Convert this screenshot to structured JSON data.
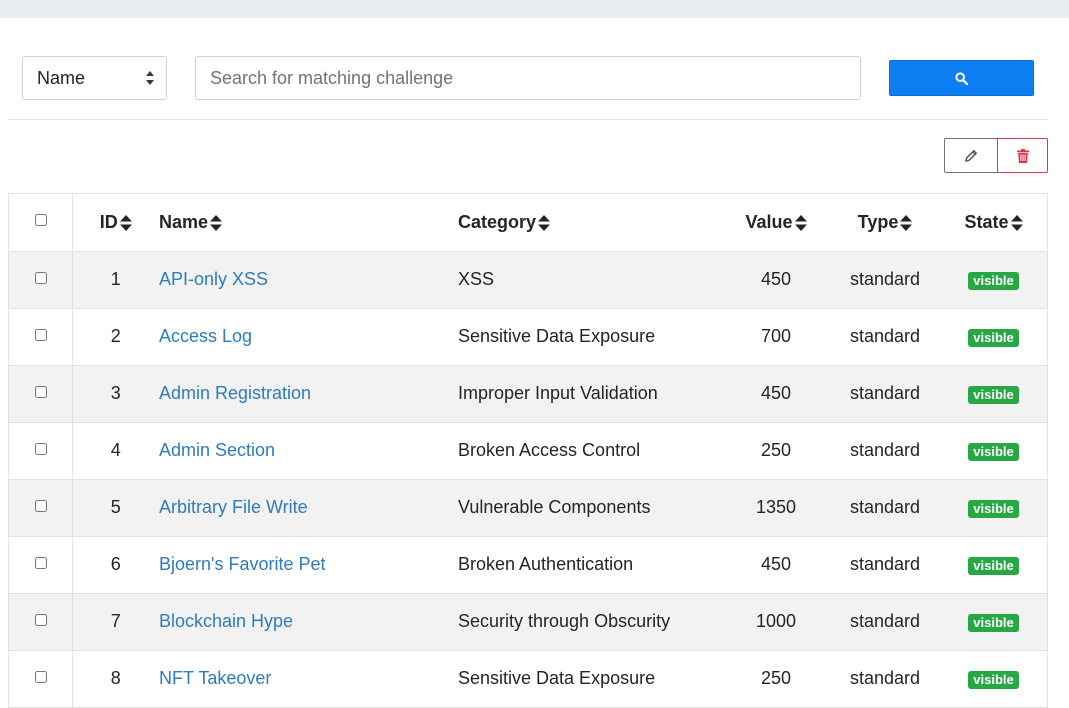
{
  "search": {
    "field_value": "Name",
    "placeholder": "Search for matching challenge",
    "search_icon": "search-icon"
  },
  "actions": {
    "edit_icon": "pencil-icon",
    "delete_icon": "trash-icon"
  },
  "table": {
    "headers": {
      "id": "ID",
      "name": "Name",
      "category": "Category",
      "value": "Value",
      "type": "Type",
      "state": "State"
    },
    "rows": [
      {
        "id": "1",
        "name": "API-only XSS",
        "category": "XSS",
        "value": "450",
        "type": "standard",
        "state": "visible"
      },
      {
        "id": "2",
        "name": "Access Log",
        "category": "Sensitive Data Exposure",
        "value": "700",
        "type": "standard",
        "state": "visible"
      },
      {
        "id": "3",
        "name": "Admin Registration",
        "category": "Improper Input Validation",
        "value": "450",
        "type": "standard",
        "state": "visible"
      },
      {
        "id": "4",
        "name": "Admin Section",
        "category": "Broken Access Control",
        "value": "250",
        "type": "standard",
        "state": "visible"
      },
      {
        "id": "5",
        "name": "Arbitrary File Write",
        "category": "Vulnerable Components",
        "value": "1350",
        "type": "standard",
        "state": "visible"
      },
      {
        "id": "6",
        "name": "Bjoern's Favorite Pet",
        "category": "Broken Authentication",
        "value": "450",
        "type": "standard",
        "state": "visible"
      },
      {
        "id": "7",
        "name": "Blockchain Hype",
        "category": "Security through Obscurity",
        "value": "1000",
        "type": "standard",
        "state": "visible"
      },
      {
        "id": "8",
        "name": "NFT Takeover",
        "category": "Sensitive Data Exposure",
        "value": "250",
        "type": "standard",
        "state": "visible"
      }
    ]
  },
  "colors": {
    "primary": "#0d7ff2",
    "danger": "#dc3545",
    "link": "#2e7bbd",
    "badge_visible": "#28a745"
  }
}
